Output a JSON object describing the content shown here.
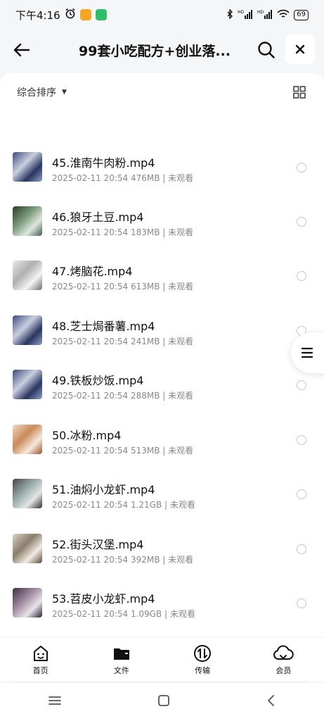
{
  "status_bar": {
    "time": "下午4:16",
    "battery": "69",
    "hd1": "HD",
    "hd2": "HD"
  },
  "header": {
    "title": "99套小吃配方+创业落..."
  },
  "sort": {
    "label": "综合排序"
  },
  "files": [
    {
      "name": "45.淮南牛肉粉.mp4",
      "meta": "2025-02-11 20:54  476MB | 未观看"
    },
    {
      "name": "46.狼牙土豆.mp4",
      "meta": "2025-02-11 20:54  183MB | 未观看"
    },
    {
      "name": "47.烤脑花.mp4",
      "meta": "2025-02-11 20:54  613MB | 未观看"
    },
    {
      "name": "48.芝士焗番薯.mp4",
      "meta": "2025-02-11 20:54  241MB | 未观看"
    },
    {
      "name": "49.铁板炒饭.mp4",
      "meta": "2025-02-11 20:54  288MB | 未观看"
    },
    {
      "name": "50.冰粉.mp4",
      "meta": "2025-02-11 20:54  513MB | 未观看"
    },
    {
      "name": "51.油焖小龙虾.mp4",
      "meta": "2025-02-11 20:54  1.21GB | 未观看"
    },
    {
      "name": "52.街头汉堡.mp4",
      "meta": "2025-02-11 20:54  392MB | 未观看"
    },
    {
      "name": "53.苕皮小龙虾.mp4",
      "meta": "2025-02-11 20:54  1.09GB | 未观看"
    }
  ],
  "tabs": [
    {
      "label": "首页",
      "icon": "home-icon"
    },
    {
      "label": "文件",
      "icon": "folder-icon"
    },
    {
      "label": "传输",
      "icon": "transfer-icon"
    },
    {
      "label": "会员",
      "icon": "cloud-icon"
    }
  ],
  "colors": {
    "accent": "#111111",
    "meta": "#888888",
    "background": "#f5f6f8"
  }
}
